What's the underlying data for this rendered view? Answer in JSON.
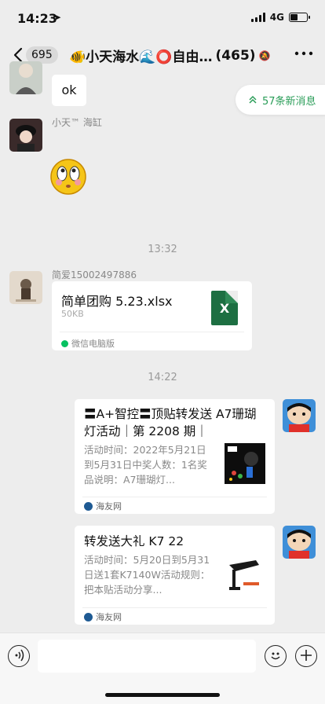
{
  "status_bar": {
    "time": "14:23",
    "network": "4G"
  },
  "header": {
    "unread_count": "695",
    "title": "🐠小天海水🌊⭕自由…",
    "member_count": "(465)"
  },
  "new_messages_pill": {
    "label": "57条新消息"
  },
  "messages": {
    "m1": {
      "text": "ok"
    },
    "m2": {
      "sender": "小天™ 海缸"
    },
    "t1": {
      "time": "13:32"
    },
    "m3": {
      "sender": "简爱15002497886",
      "file_name": "简单团购 5.23.xlsx",
      "file_size": "50KB",
      "file_icon_label": "X",
      "source": "微信电脑版"
    },
    "t2": {
      "time": "14:22"
    },
    "m4": {
      "title": "〓A+智控〓顶贴转发送 A7珊瑚灯活动｜第 2208 期｜",
      "description": "活动时间：2022年5月21日到5月31日中奖人数：1名奖品说明：A7珊瑚灯...",
      "source": "海友网"
    },
    "m5": {
      "title": "转发送大礼 K7 22",
      "description": "活动时间：5月20日到5月31日送1套K7140W活动规则：把本贴活动分享...",
      "source": "海友网"
    }
  },
  "input_bar": {}
}
